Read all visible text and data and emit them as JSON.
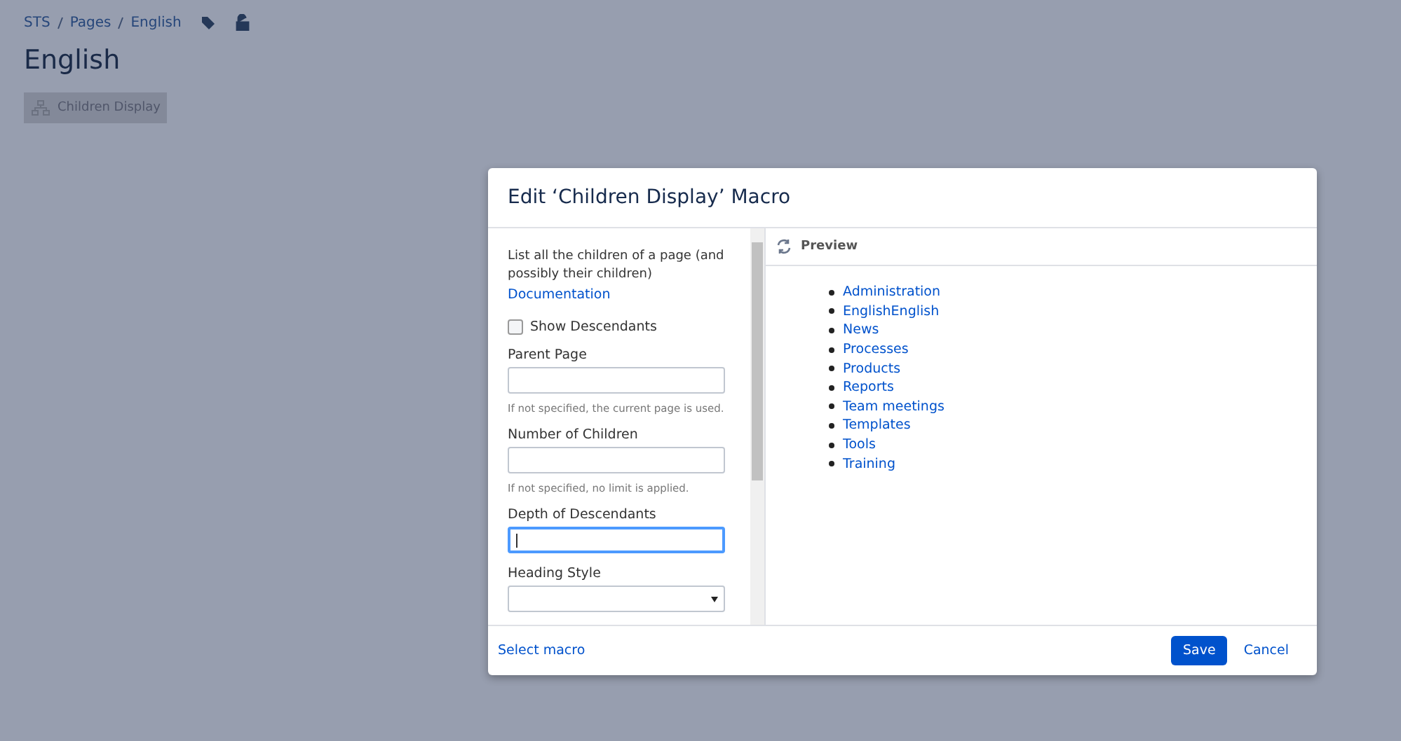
{
  "breadcrumbs": [
    {
      "label": "STS"
    },
    {
      "label": "Pages"
    },
    {
      "label": "English"
    }
  ],
  "page_title": "English",
  "macro_placeholder": {
    "label": "Children Display"
  },
  "dialog": {
    "title": "Edit ‘Children Display’ Macro",
    "description": "List all the children of a page (and possibly their children)",
    "documentation_link": "Documentation",
    "fields": [
      {
        "kind": "checkbox",
        "label": "Show Descendants",
        "checked": false
      },
      {
        "kind": "text",
        "label": "Parent Page",
        "hint": "If not specified, the current page is used.",
        "focused": false
      },
      {
        "kind": "text",
        "label": "Number of Children",
        "hint": "If not specified, no limit is applied.",
        "focused": false
      },
      {
        "kind": "text",
        "label": "Depth of Descendants",
        "focused": true
      },
      {
        "kind": "select",
        "label": "Heading Style"
      }
    ],
    "preview": {
      "title": "Preview",
      "items": [
        "Administration",
        "EnglishEnglish",
        "News",
        "Processes",
        "Products",
        "Reports",
        "Team meetings",
        "Templates",
        "Tools",
        "Training"
      ]
    },
    "footer": {
      "link": "Select macro",
      "buttons": [
        {
          "label": "Save",
          "kind": "primary"
        },
        {
          "label": "Cancel",
          "kind": "link"
        }
      ]
    }
  }
}
